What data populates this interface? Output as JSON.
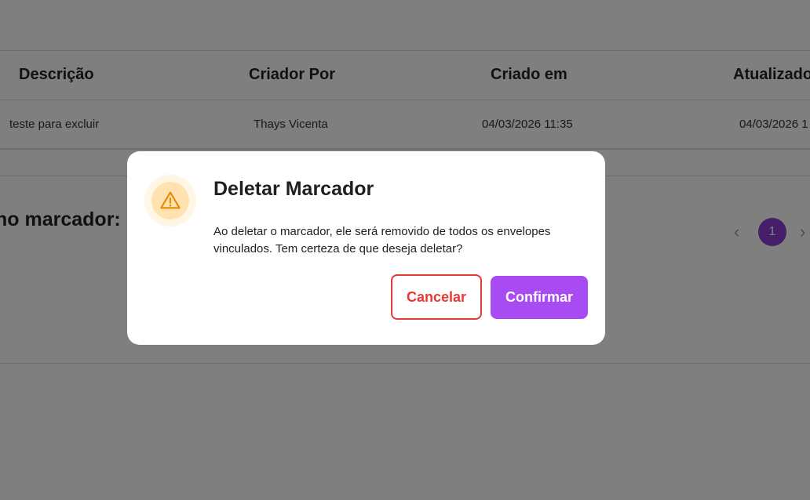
{
  "table": {
    "headers": {
      "descricao": "Descrição",
      "criador": "Criador Por",
      "criado_em": "Criado em",
      "atualizado": "Atualizado"
    },
    "row": {
      "descricao": "teste para excluir",
      "criador": "Thays Vicenta",
      "criado_em": "04/03/2026 11:35",
      "atualizado": "04/03/2026 1"
    }
  },
  "section": {
    "label": "no marcador:"
  },
  "pagination": {
    "prev_icon": "‹",
    "current_page": "1",
    "next_icon": "›"
  },
  "modal": {
    "icon": "warning-icon",
    "title": "Deletar Marcador",
    "message": "Ao deletar o marcador, ele será removido de todos os envelopes vinculados. Tem certeza de que deseja deletar?",
    "cancel_label": "Cancelar",
    "confirm_label": "Confirmar"
  },
  "colors": {
    "accent": "#a94bf2",
    "danger": "#e53935",
    "page_active": "#8a3fd6",
    "warning_bg": "#ffe2b0",
    "warning_icon": "#e68a00"
  }
}
